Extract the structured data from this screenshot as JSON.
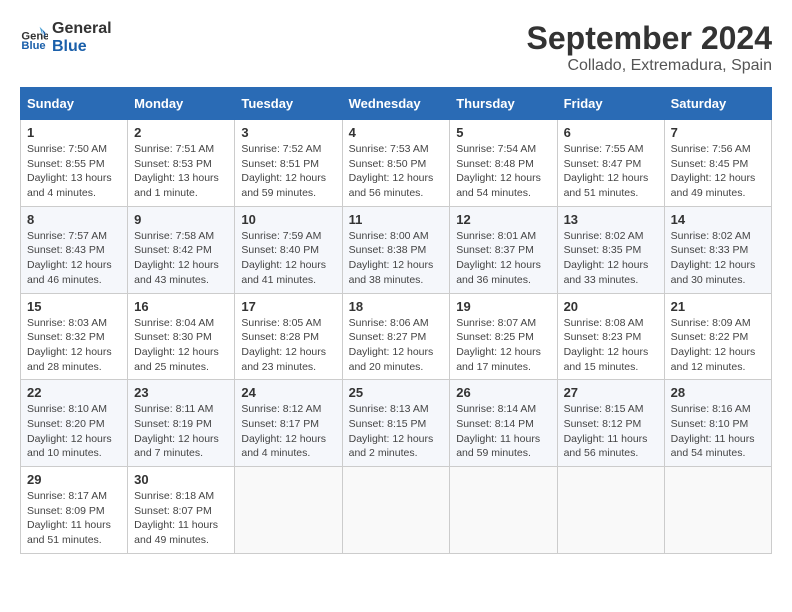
{
  "header": {
    "logo_general": "General",
    "logo_blue": "Blue",
    "main_title": "September 2024",
    "subtitle": "Collado, Extremadura, Spain"
  },
  "calendar": {
    "weekdays": [
      "Sunday",
      "Monday",
      "Tuesday",
      "Wednesday",
      "Thursday",
      "Friday",
      "Saturday"
    ],
    "weeks": [
      [
        {
          "day": "1",
          "sunrise": "Sunrise: 7:50 AM",
          "sunset": "Sunset: 8:55 PM",
          "daylight": "Daylight: 13 hours and 4 minutes."
        },
        {
          "day": "2",
          "sunrise": "Sunrise: 7:51 AM",
          "sunset": "Sunset: 8:53 PM",
          "daylight": "Daylight: 13 hours and 1 minute."
        },
        {
          "day": "3",
          "sunrise": "Sunrise: 7:52 AM",
          "sunset": "Sunset: 8:51 PM",
          "daylight": "Daylight: 12 hours and 59 minutes."
        },
        {
          "day": "4",
          "sunrise": "Sunrise: 7:53 AM",
          "sunset": "Sunset: 8:50 PM",
          "daylight": "Daylight: 12 hours and 56 minutes."
        },
        {
          "day": "5",
          "sunrise": "Sunrise: 7:54 AM",
          "sunset": "Sunset: 8:48 PM",
          "daylight": "Daylight: 12 hours and 54 minutes."
        },
        {
          "day": "6",
          "sunrise": "Sunrise: 7:55 AM",
          "sunset": "Sunset: 8:47 PM",
          "daylight": "Daylight: 12 hours and 51 minutes."
        },
        {
          "day": "7",
          "sunrise": "Sunrise: 7:56 AM",
          "sunset": "Sunset: 8:45 PM",
          "daylight": "Daylight: 12 hours and 49 minutes."
        }
      ],
      [
        {
          "day": "8",
          "sunrise": "Sunrise: 7:57 AM",
          "sunset": "Sunset: 8:43 PM",
          "daylight": "Daylight: 12 hours and 46 minutes."
        },
        {
          "day": "9",
          "sunrise": "Sunrise: 7:58 AM",
          "sunset": "Sunset: 8:42 PM",
          "daylight": "Daylight: 12 hours and 43 minutes."
        },
        {
          "day": "10",
          "sunrise": "Sunrise: 7:59 AM",
          "sunset": "Sunset: 8:40 PM",
          "daylight": "Daylight: 12 hours and 41 minutes."
        },
        {
          "day": "11",
          "sunrise": "Sunrise: 8:00 AM",
          "sunset": "Sunset: 8:38 PM",
          "daylight": "Daylight: 12 hours and 38 minutes."
        },
        {
          "day": "12",
          "sunrise": "Sunrise: 8:01 AM",
          "sunset": "Sunset: 8:37 PM",
          "daylight": "Daylight: 12 hours and 36 minutes."
        },
        {
          "day": "13",
          "sunrise": "Sunrise: 8:02 AM",
          "sunset": "Sunset: 8:35 PM",
          "daylight": "Daylight: 12 hours and 33 minutes."
        },
        {
          "day": "14",
          "sunrise": "Sunrise: 8:02 AM",
          "sunset": "Sunset: 8:33 PM",
          "daylight": "Daylight: 12 hours and 30 minutes."
        }
      ],
      [
        {
          "day": "15",
          "sunrise": "Sunrise: 8:03 AM",
          "sunset": "Sunset: 8:32 PM",
          "daylight": "Daylight: 12 hours and 28 minutes."
        },
        {
          "day": "16",
          "sunrise": "Sunrise: 8:04 AM",
          "sunset": "Sunset: 8:30 PM",
          "daylight": "Daylight: 12 hours and 25 minutes."
        },
        {
          "day": "17",
          "sunrise": "Sunrise: 8:05 AM",
          "sunset": "Sunset: 8:28 PM",
          "daylight": "Daylight: 12 hours and 23 minutes."
        },
        {
          "day": "18",
          "sunrise": "Sunrise: 8:06 AM",
          "sunset": "Sunset: 8:27 PM",
          "daylight": "Daylight: 12 hours and 20 minutes."
        },
        {
          "day": "19",
          "sunrise": "Sunrise: 8:07 AM",
          "sunset": "Sunset: 8:25 PM",
          "daylight": "Daylight: 12 hours and 17 minutes."
        },
        {
          "day": "20",
          "sunrise": "Sunrise: 8:08 AM",
          "sunset": "Sunset: 8:23 PM",
          "daylight": "Daylight: 12 hours and 15 minutes."
        },
        {
          "day": "21",
          "sunrise": "Sunrise: 8:09 AM",
          "sunset": "Sunset: 8:22 PM",
          "daylight": "Daylight: 12 hours and 12 minutes."
        }
      ],
      [
        {
          "day": "22",
          "sunrise": "Sunrise: 8:10 AM",
          "sunset": "Sunset: 8:20 PM",
          "daylight": "Daylight: 12 hours and 10 minutes."
        },
        {
          "day": "23",
          "sunrise": "Sunrise: 8:11 AM",
          "sunset": "Sunset: 8:19 PM",
          "daylight": "Daylight: 12 hours and 7 minutes."
        },
        {
          "day": "24",
          "sunrise": "Sunrise: 8:12 AM",
          "sunset": "Sunset: 8:17 PM",
          "daylight": "Daylight: 12 hours and 4 minutes."
        },
        {
          "day": "25",
          "sunrise": "Sunrise: 8:13 AM",
          "sunset": "Sunset: 8:15 PM",
          "daylight": "Daylight: 12 hours and 2 minutes."
        },
        {
          "day": "26",
          "sunrise": "Sunrise: 8:14 AM",
          "sunset": "Sunset: 8:14 PM",
          "daylight": "Daylight: 11 hours and 59 minutes."
        },
        {
          "day": "27",
          "sunrise": "Sunrise: 8:15 AM",
          "sunset": "Sunset: 8:12 PM",
          "daylight": "Daylight: 11 hours and 56 minutes."
        },
        {
          "day": "28",
          "sunrise": "Sunrise: 8:16 AM",
          "sunset": "Sunset: 8:10 PM",
          "daylight": "Daylight: 11 hours and 54 minutes."
        }
      ],
      [
        {
          "day": "29",
          "sunrise": "Sunrise: 8:17 AM",
          "sunset": "Sunset: 8:09 PM",
          "daylight": "Daylight: 11 hours and 51 minutes."
        },
        {
          "day": "30",
          "sunrise": "Sunrise: 8:18 AM",
          "sunset": "Sunset: 8:07 PM",
          "daylight": "Daylight: 11 hours and 49 minutes."
        },
        null,
        null,
        null,
        null,
        null
      ]
    ]
  }
}
